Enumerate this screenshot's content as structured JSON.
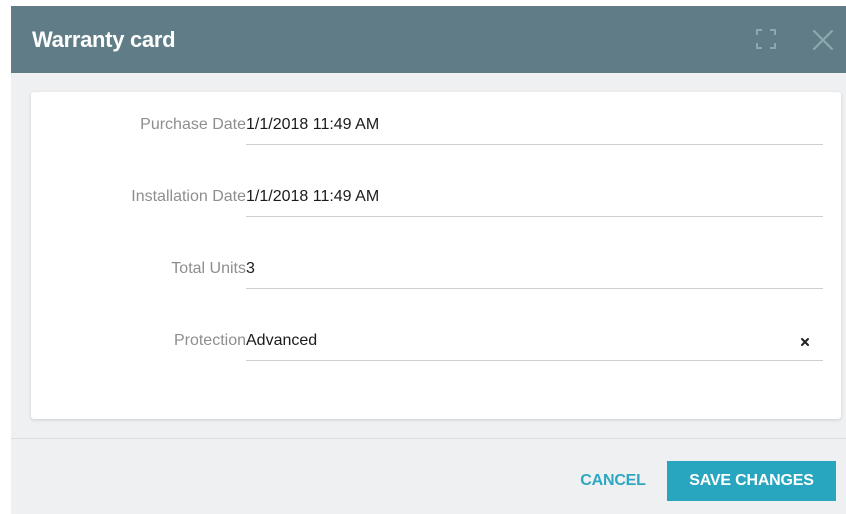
{
  "dialog": {
    "title": "Warranty card",
    "icons": {
      "maximize": "maximize-icon",
      "close": "close-icon"
    }
  },
  "form": {
    "fields": [
      {
        "label": "Purchase Date",
        "value": "1/1/2018 11:49 AM"
      },
      {
        "label": "Installation Date",
        "value": "1/1/2018 11:49 AM"
      },
      {
        "label": "Total Units",
        "value": "3"
      },
      {
        "label": "Protection",
        "value": "Advanced"
      }
    ]
  },
  "footer": {
    "cancel_label": "CANCEL",
    "save_label": "SAVE CHANGES"
  },
  "colors": {
    "titlebar": "#607d87",
    "accent": "#29a6bf",
    "dialog_bg": "#eef0f2"
  }
}
